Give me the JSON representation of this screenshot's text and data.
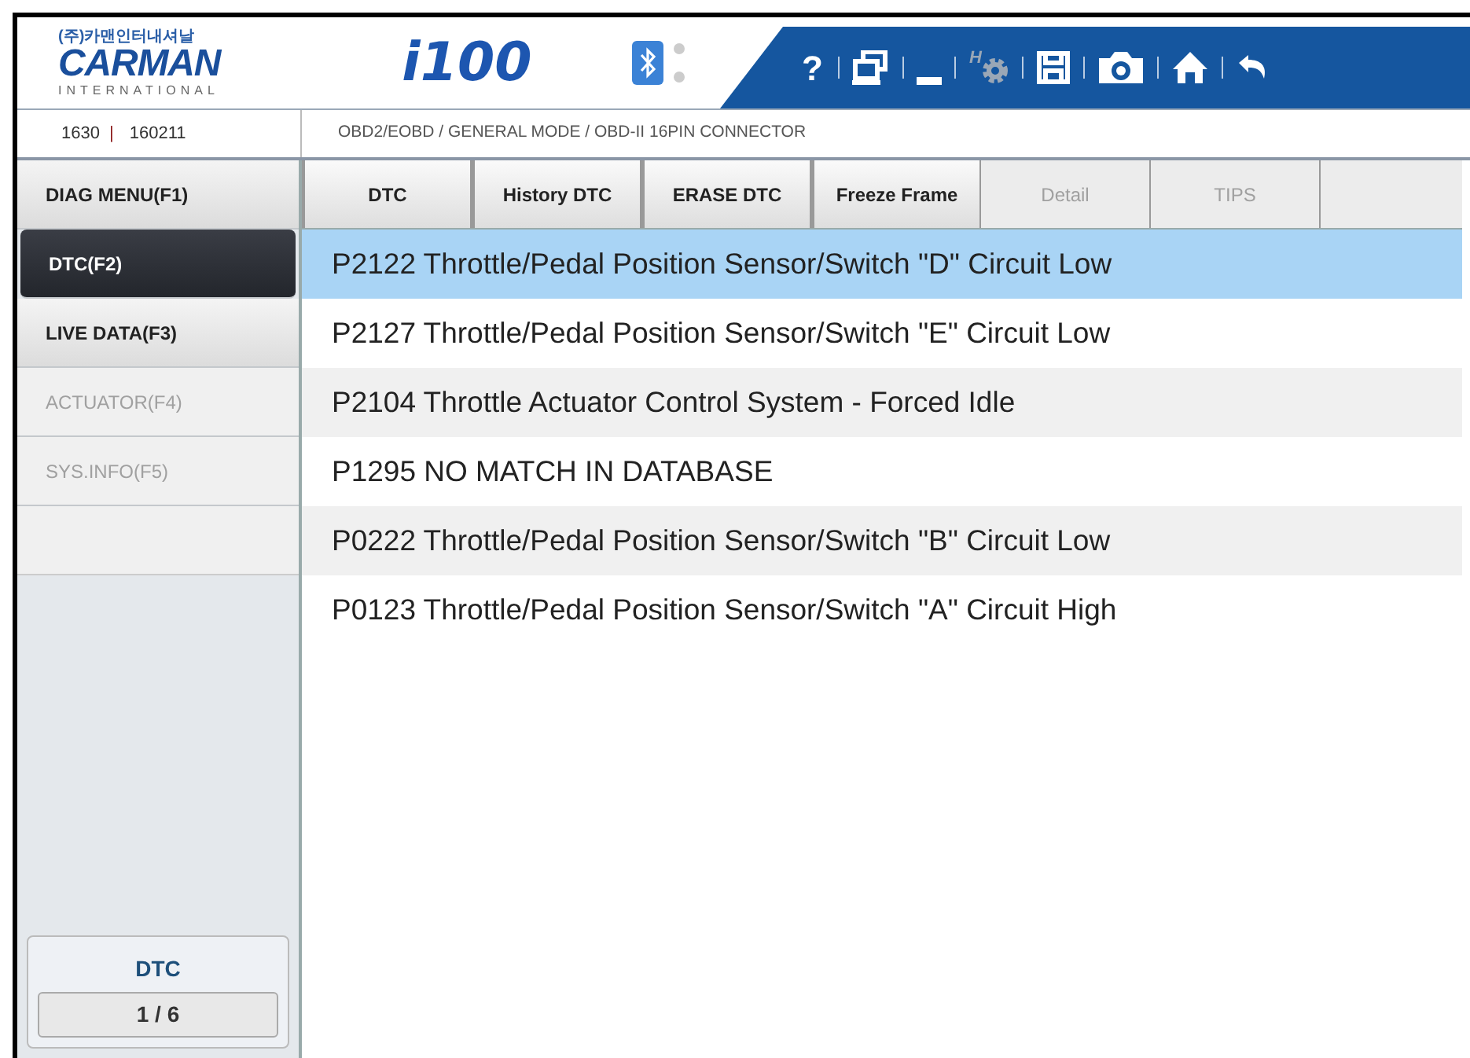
{
  "logo": {
    "korean": "(주)카맨인터내셔날",
    "name": "CARMAN",
    "subtitle": "INTERNATIONAL"
  },
  "product": {
    "prefix": "i",
    "number": "100"
  },
  "toolbar": [
    {
      "kind": "help",
      "label": "?"
    },
    {
      "kind": "windows"
    },
    {
      "kind": "minimize"
    },
    {
      "kind": "gear",
      "label": "H"
    },
    {
      "kind": "save"
    },
    {
      "kind": "camera"
    },
    {
      "kind": "home"
    },
    {
      "kind": "back"
    }
  ],
  "info": {
    "code": "1630",
    "separator": "|",
    "date": "160211",
    "path": "OBD2/EOBD / GENERAL MODE / OBD-II 16PIN CONNECTOR"
  },
  "sidebar": {
    "items": [
      {
        "label": "DIAG MENU(F1)",
        "selected": false,
        "disabled": false
      },
      {
        "label": "DTC(F2)",
        "selected": true,
        "disabled": false
      },
      {
        "label": "LIVE DATA(F3)",
        "selected": false,
        "disabled": false
      },
      {
        "label": "ACTUATOR(F4)",
        "selected": false,
        "disabled": true
      },
      {
        "label": "SYS.INFO(F5)",
        "selected": false,
        "disabled": true
      }
    ],
    "counter": {
      "title": "DTC",
      "value": "1 / 6"
    }
  },
  "tabs": [
    {
      "label": "DTC",
      "disabled": false
    },
    {
      "label": "History DTC",
      "disabled": false
    },
    {
      "label": "ERASE DTC",
      "disabled": false
    },
    {
      "label": "Freeze Frame",
      "disabled": false
    },
    {
      "label": "Detail",
      "disabled": true
    },
    {
      "label": "TIPS",
      "disabled": true
    }
  ],
  "rows": [
    {
      "text": "P2122 Throttle/Pedal Position Sensor/Switch \"D\" Circuit Low",
      "selected": true
    },
    {
      "text": "P2127 Throttle/Pedal Position Sensor/Switch \"E\" Circuit Low",
      "selected": false
    },
    {
      "text": "P2104 Throttle Actuator Control System - Forced Idle",
      "selected": false
    },
    {
      "text": "P1295 NO MATCH IN DATABASE",
      "selected": false
    },
    {
      "text": "P0222 Throttle/Pedal Position Sensor/Switch \"B\" Circuit Low",
      "selected": false
    },
    {
      "text": "P0123 Throttle/Pedal Position Sensor/Switch \"A\" Circuit High",
      "selected": false
    }
  ]
}
